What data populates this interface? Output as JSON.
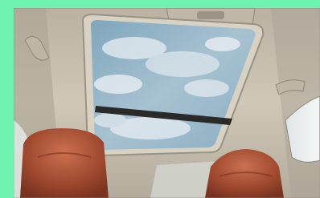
{
  "image": {
    "border_color": "#6df2b0",
    "palette": {
      "headliner": "#c9c2b2",
      "headliner_shadow": "#a9a294",
      "sky": "#8fb3c7",
      "cloud": "#e8eef2",
      "seat_leather": "#a24a30",
      "seat_highlight": "#c9714f",
      "trim_dark": "#2a2a28"
    }
  }
}
